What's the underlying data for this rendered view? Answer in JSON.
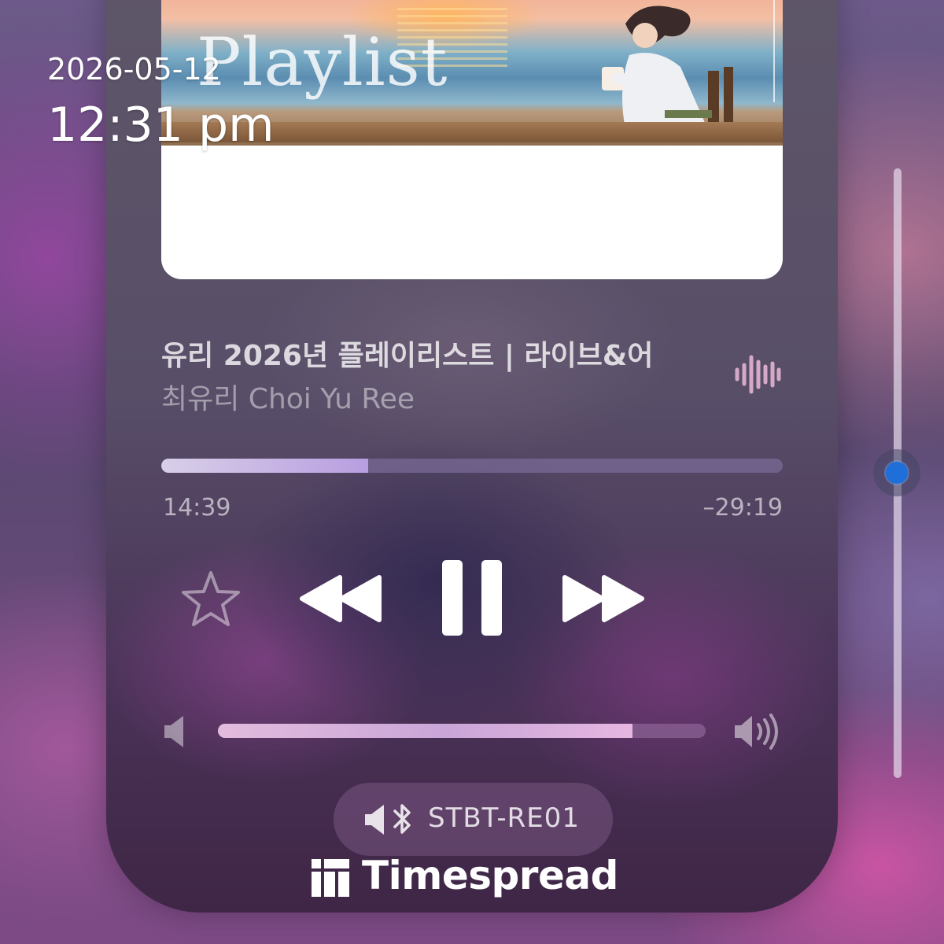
{
  "status": {
    "date": "2026-05-12",
    "time": "12:31 pm"
  },
  "album": {
    "art_title": "Playlist"
  },
  "now_playing": {
    "title": "유리 2026년 플레이리스트 | 라이브&어",
    "artist": "최유리 Choi Yu Ree",
    "elapsed": "14:39",
    "remaining": "–29:19",
    "progress_fraction": 0.333
  },
  "controls": {
    "favorite_icon": "star-icon",
    "rewind_icon": "rewind-icon",
    "pause_icon": "pause-icon",
    "forward_icon": "fast-forward-icon",
    "waveform_icon": "waveform-icon"
  },
  "volume": {
    "level_fraction": 0.85,
    "low_icon": "speaker-low-icon",
    "high_icon": "speaker-high-icon"
  },
  "output": {
    "device": "STBT-RE01",
    "icon": "bluetooth-speaker-icon"
  },
  "brand": {
    "name": "Timespread"
  },
  "side_slider": {
    "level_fraction": 0.49
  },
  "colors": {
    "accent_blue": "#1e6fd9",
    "progress_fill": "#b89ee0",
    "volume_fill": "#e3bcdd"
  }
}
